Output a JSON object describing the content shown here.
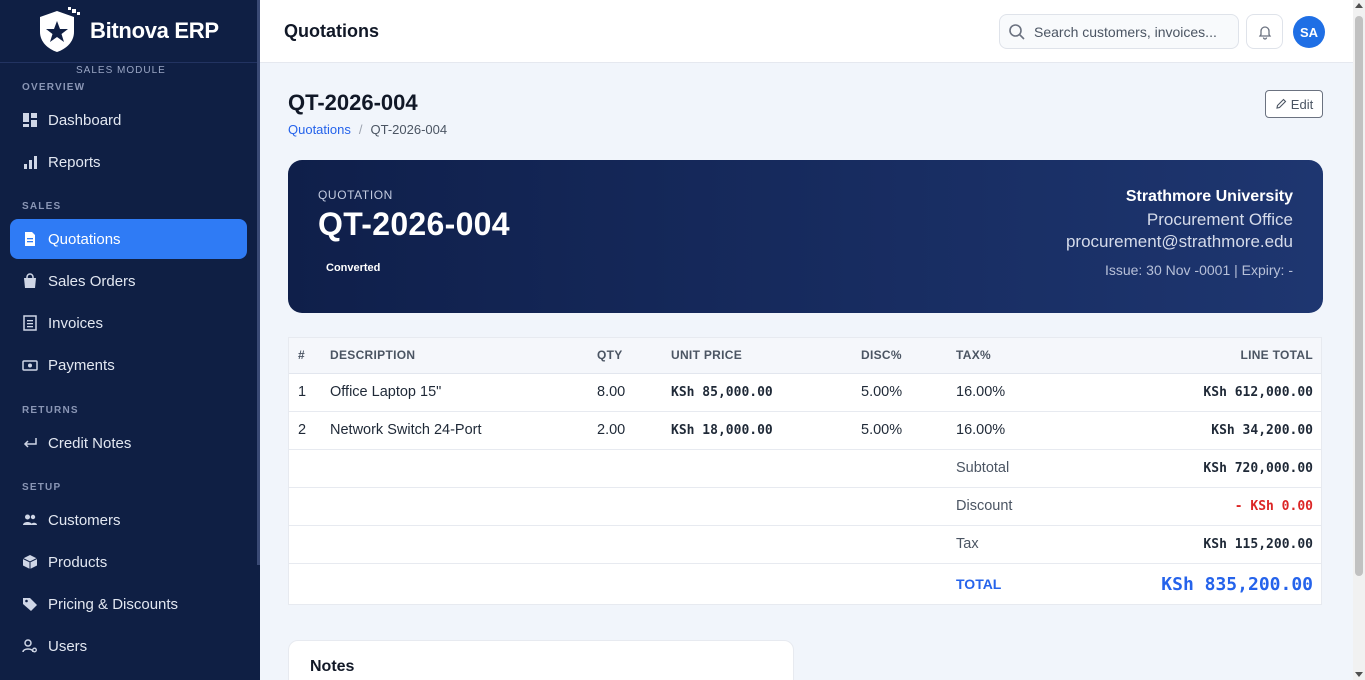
{
  "app": {
    "brand": "Bitnova ERP",
    "module": "SALES MODULE",
    "colors": {
      "sidebar": "#0f1f44",
      "accent": "#2f7bf5",
      "negative": "#dc2626"
    }
  },
  "sidebar": {
    "sections": {
      "overview": "OVERVIEW",
      "sales": "SALES",
      "returns": "RETURNS",
      "setup": "SETUP"
    },
    "items": {
      "dashboard": {
        "label": "Dashboard",
        "icon": "dashboard-icon"
      },
      "reports": {
        "label": "Reports",
        "icon": "bar-chart-icon"
      },
      "quotations": {
        "label": "Quotations",
        "icon": "document-icon",
        "active": true
      },
      "sales_orders": {
        "label": "Sales Orders",
        "icon": "shopping-bag-icon"
      },
      "invoices": {
        "label": "Invoices",
        "icon": "invoice-icon"
      },
      "payments": {
        "label": "Payments",
        "icon": "cash-icon"
      },
      "credit_notes": {
        "label": "Credit Notes",
        "icon": "return-arrow-icon"
      },
      "customers": {
        "label": "Customers",
        "icon": "users-icon"
      },
      "products": {
        "label": "Products",
        "icon": "box-icon"
      },
      "pricing": {
        "label": "Pricing & Discounts",
        "icon": "tag-icon"
      },
      "users": {
        "label": "Users",
        "icon": "user-gear-icon"
      }
    }
  },
  "topbar": {
    "title": "Quotations",
    "search_placeholder": "Search customers, invoices...",
    "avatar_initials": "SA"
  },
  "page": {
    "heading": "QT-2026-004",
    "breadcrumb": {
      "parent": "Quotations",
      "separator": "/",
      "current": "QT-2026-004"
    },
    "edit_label": "Edit"
  },
  "quotation": {
    "kicker": "QUOTATION",
    "number": "QT-2026-004",
    "status": "Converted",
    "customer": {
      "name": "Strathmore University",
      "department": "Procurement Office",
      "email": "procurement@strathmore.edu"
    },
    "dates": "Issue: 30 Nov -0001 | Expiry: -"
  },
  "table": {
    "headers": {
      "idx": "#",
      "description": "DESCRIPTION",
      "qty": "QTY",
      "unit_price": "UNIT PRICE",
      "disc": "DISC%",
      "tax": "TAX%",
      "line_total": "LINE TOTAL"
    },
    "rows": [
      {
        "idx": "1",
        "description": "Office Laptop 15\"",
        "qty": "8.00",
        "unit_price": "KSh 85,000.00",
        "disc": "5.00%",
        "tax": "16.00%",
        "line_total": "KSh 612,000.00"
      },
      {
        "idx": "2",
        "description": "Network Switch 24-Port",
        "qty": "2.00",
        "unit_price": "KSh 18,000.00",
        "disc": "5.00%",
        "tax": "16.00%",
        "line_total": "KSh 34,200.00"
      }
    ],
    "summary": {
      "subtotal_label": "Subtotal",
      "subtotal": "KSh 720,000.00",
      "discount_label": "Discount",
      "discount": "- KSh 0.00",
      "tax_label": "Tax",
      "tax": "KSh 115,200.00",
      "total_label": "TOTAL",
      "total": "KSh 835,200.00"
    }
  },
  "notes": {
    "title": "Notes"
  }
}
